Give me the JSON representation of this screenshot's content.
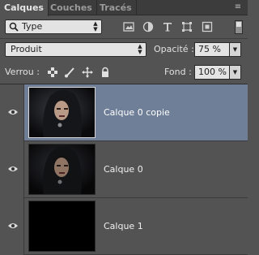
{
  "tabs": [
    {
      "label": "Calques",
      "active": true
    },
    {
      "label": "Couches",
      "active": false
    },
    {
      "label": "Tracés",
      "active": false
    }
  ],
  "filter": {
    "kind_label": "Type",
    "icons": [
      "image-filter-icon",
      "adjustment-filter-icon",
      "text-filter-icon",
      "shape-filter-icon",
      "smart-object-filter-icon"
    ]
  },
  "blend": {
    "mode": "Produit",
    "opacity_label": "Opacité :",
    "opacity_value": "75 %"
  },
  "lock": {
    "label": "Verrou :",
    "icons": [
      "lock-transparency-icon",
      "lock-pixels-icon",
      "lock-position-icon",
      "lock-all-icon"
    ],
    "fill_label": "Fond :",
    "fill_value": "100 %"
  },
  "layers": [
    {
      "name": "Calque 0 copie",
      "selected": true,
      "visible": true,
      "thumbnail": "portrait"
    },
    {
      "name": "Calque 0",
      "selected": false,
      "visible": true,
      "thumbnail": "portrait"
    },
    {
      "name": "Calque 1",
      "selected": false,
      "visible": true,
      "thumbnail": "black"
    }
  ],
  "colors": {
    "panel": "#535353",
    "selection": "#6f7f97"
  }
}
